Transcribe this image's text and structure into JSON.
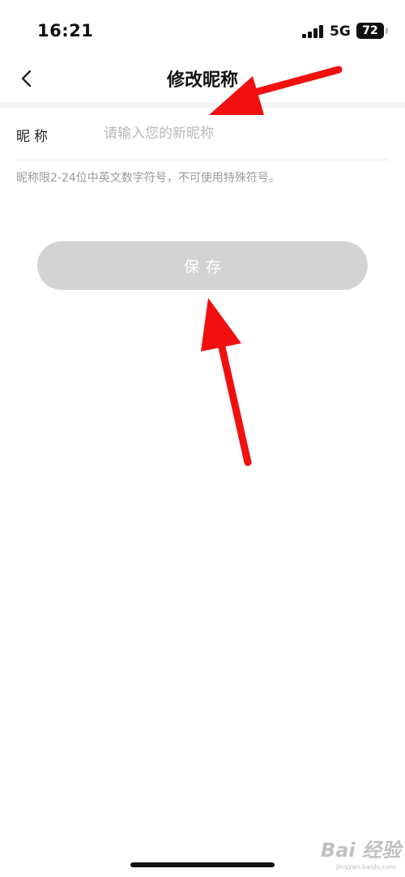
{
  "status_bar": {
    "time": "16:21",
    "network": "5G",
    "battery": "72"
  },
  "header": {
    "title": "修改昵称",
    "back_icon": "chevron-left-icon"
  },
  "form": {
    "label": "昵称",
    "input_value": "",
    "placeholder": "请输入您的新昵称",
    "hint": "昵称限2-24位中英文数字符号，不可使用特殊符号。"
  },
  "actions": {
    "save_label": "保存"
  },
  "colors": {
    "button_disabled": "#d3d3d3",
    "annotation_arrow": "#f01010",
    "placeholder": "#b9b9b9"
  },
  "watermark": {
    "brand": "Bai 经验",
    "url": "jingyan.baidu.com"
  }
}
